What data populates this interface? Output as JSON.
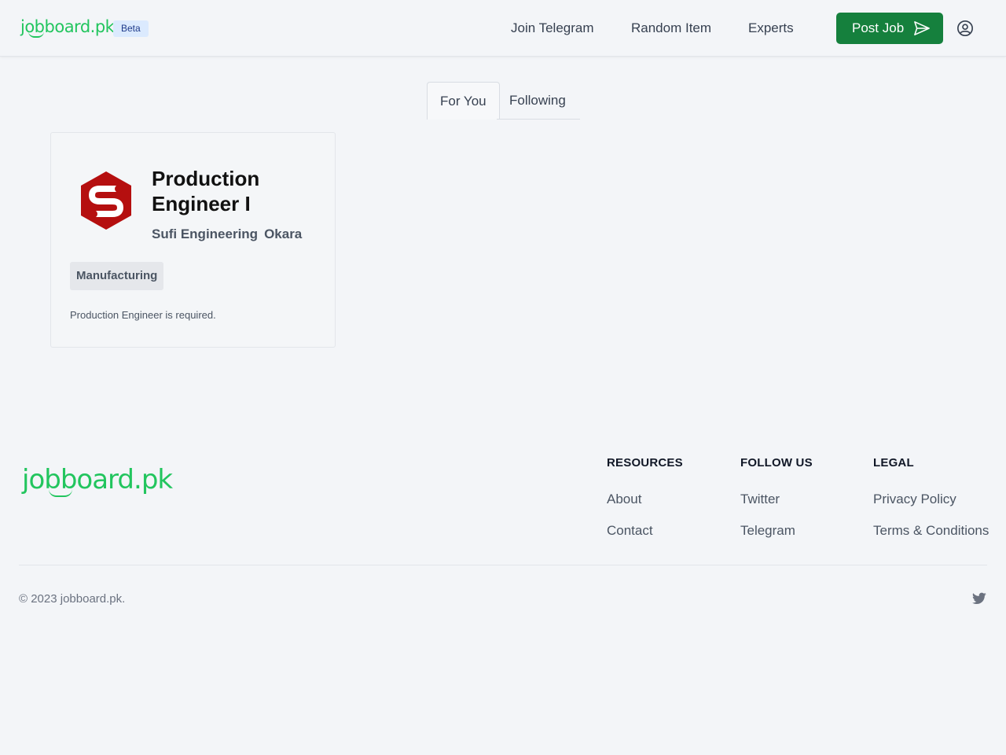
{
  "header": {
    "logo": "jobboard.pk",
    "badge": "Beta",
    "nav": [
      "Join Telegram",
      "Random Item",
      "Experts"
    ],
    "post_button": "Post Job"
  },
  "tabs": [
    "For You",
    "Following"
  ],
  "job": {
    "title": "Production Engineer I",
    "company": "Sufi Engineering",
    "location": "Okara",
    "tag": "Manufacturing",
    "description": "Production Engineer is required."
  },
  "footer": {
    "logo": "jobboard.pk",
    "columns": [
      {
        "heading": "RESOURCES",
        "links": [
          "About",
          "Contact"
        ]
      },
      {
        "heading": "FOLLOW US",
        "links": [
          "Twitter",
          "Telegram"
        ]
      },
      {
        "heading": "LEGAL",
        "links": [
          "Privacy Policy",
          "Terms & Conditions"
        ]
      }
    ],
    "copyright": "© 2023 jobboard.pk."
  },
  "colors": {
    "brand_green": "#22c55e",
    "button_green": "#15803d",
    "logo_red": "#b50f0f"
  }
}
